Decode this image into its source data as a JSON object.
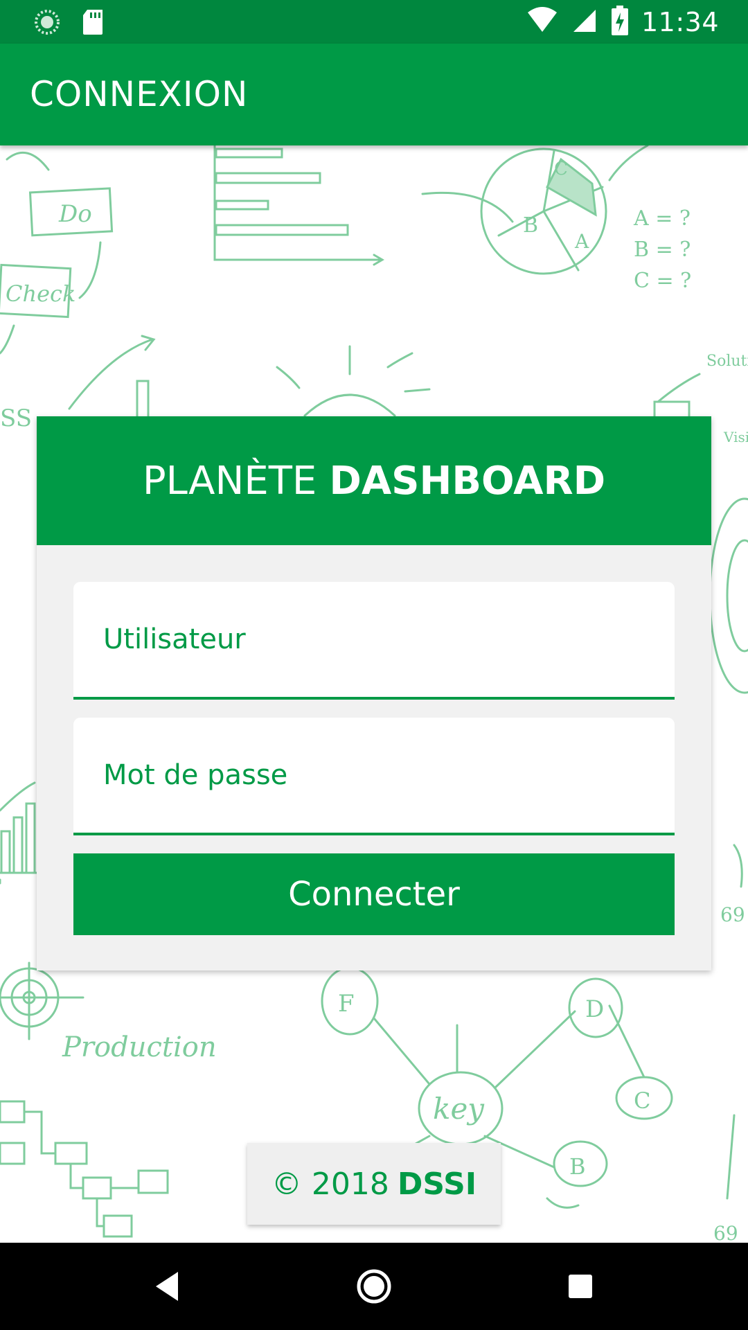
{
  "status_bar": {
    "time": "11:34",
    "icons": [
      "sync-icon",
      "sd-card-icon",
      "wifi-icon",
      "signal-icon",
      "battery-charging-icon"
    ]
  },
  "app_bar": {
    "title": "CONNEXION"
  },
  "card": {
    "header_light": "PLANÈTE",
    "header_bold": "DASHBOARD",
    "username_placeholder": "Utilisateur",
    "password_placeholder": "Mot de passe",
    "username_value": "",
    "password_value": "",
    "connect_label": "Connecter"
  },
  "footer": {
    "prefix": "© 2018",
    "owner": "DSSI"
  },
  "nav_bar": {
    "buttons": [
      "back-icon",
      "home-icon",
      "recents-icon"
    ]
  },
  "background_doodles": [
    "Do",
    "Check",
    "Production",
    "Key",
    "A",
    "B",
    "C",
    "D",
    "F",
    "Solution",
    "Vision",
    "69"
  ],
  "colors": {
    "primary": "#009a46",
    "status_bar": "#00873e",
    "doodle": "#7fcc9d",
    "card_bg": "#f1f1f1"
  }
}
